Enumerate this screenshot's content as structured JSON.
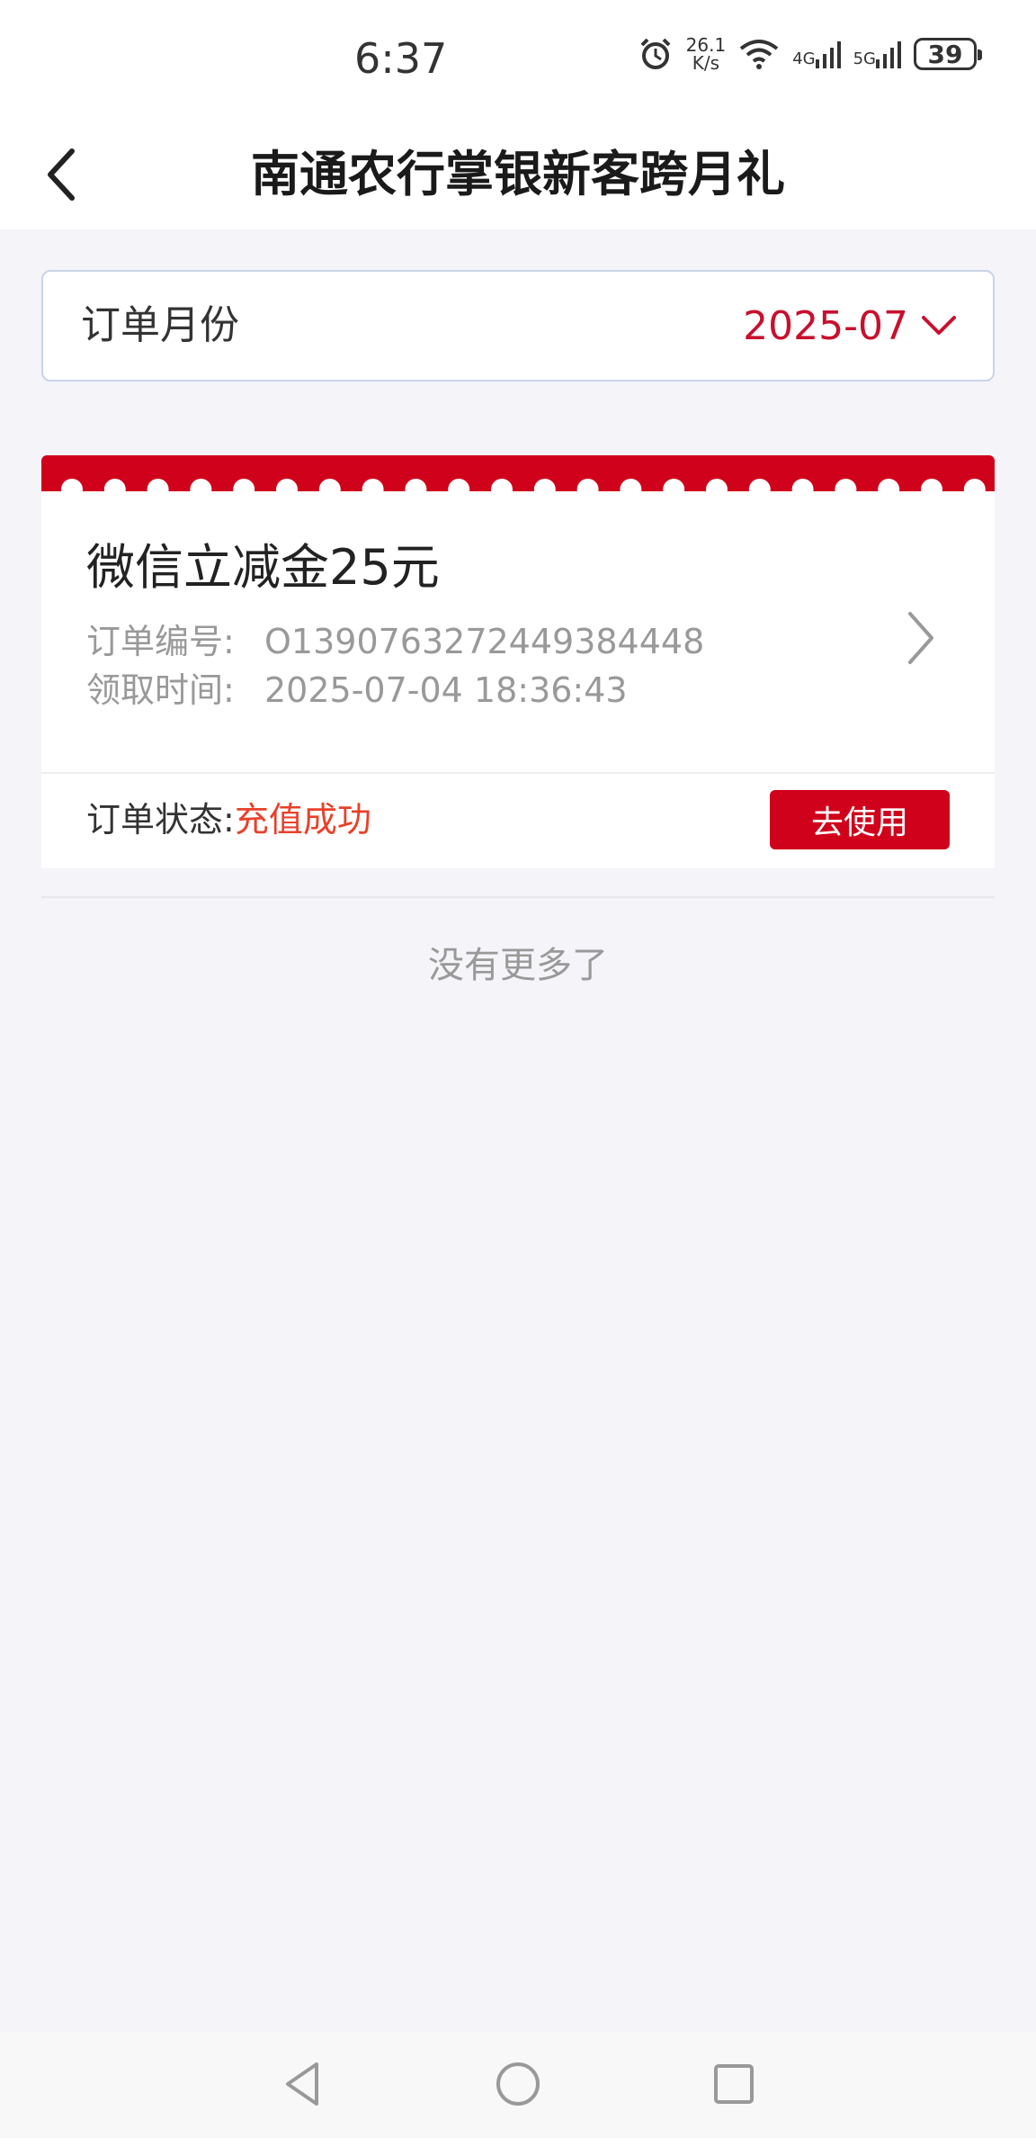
{
  "status_bar": {
    "time": "6:37",
    "speed_value": "26.1",
    "speed_unit": "K/s",
    "network_1": "4G",
    "network_2": "5G",
    "battery": "39"
  },
  "header": {
    "title": "南通农行掌银新客跨月礼",
    "back_icon": "chevron-left-icon"
  },
  "filter": {
    "label": "订单月份",
    "value": "2025-07",
    "dropdown_icon": "chevron-down-icon"
  },
  "colors": {
    "brand_red": "#d0021b",
    "status_red": "#e8412b",
    "page_bg": "#f4f4f9"
  },
  "orders": [
    {
      "name": "微信立减金25元",
      "order_no_label": "订单编号:",
      "order_no": "O1390763272449384448",
      "time_label": "领取时间:",
      "time": "2025-07-04 18:36:43",
      "status_label": "订单状态:",
      "status": "充值成功",
      "action_label": "去使用"
    }
  ],
  "list_end_text": "没有更多了",
  "nav": {
    "back_icon": "triangle-back-icon",
    "home_icon": "circle-home-icon",
    "recents_icon": "square-recents-icon"
  }
}
